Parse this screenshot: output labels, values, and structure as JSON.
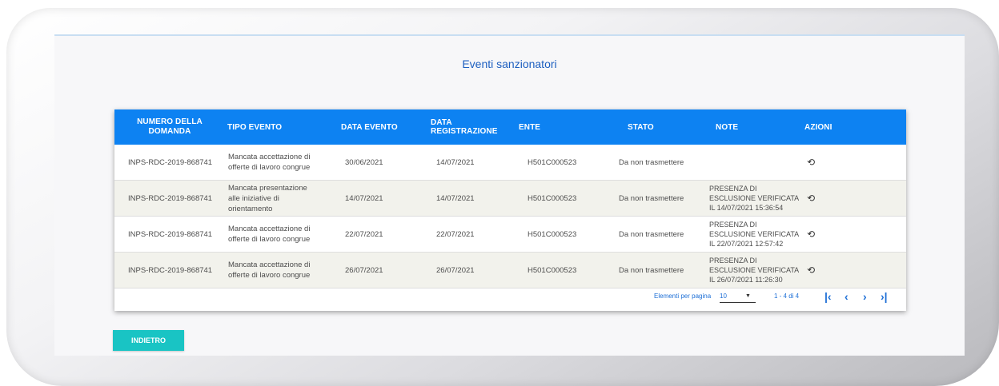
{
  "page": {
    "title": "Eventi sanzionatori"
  },
  "table": {
    "headers": {
      "numero": "NUMERO DELLA DOMANDA",
      "tipo": "TIPO EVENTO",
      "data_evento": "DATA EVENTO",
      "data_registrazione": "DATA REGISTRAZIONE",
      "ente": "ENTE",
      "stato": "STATO",
      "note": "NOTE",
      "azioni": "AZIONI"
    },
    "rows": [
      {
        "numero": "INPS-RDC-2019-868741",
        "tipo": "Mancata accettazione di offerte di lavoro congrue",
        "data_evento": "30/06/2021",
        "data_registrazione": "14/07/2021",
        "ente": "H501C000523",
        "stato": "Da non trasmettere",
        "note": ""
      },
      {
        "numero": "INPS-RDC-2019-868741",
        "tipo": "Mancata presentazione alle iniziative di orientamento",
        "data_evento": "14/07/2021",
        "data_registrazione": "14/07/2021",
        "ente": "H501C000523",
        "stato": "Da non trasmettere",
        "note": "PRESENZA DI ESCLUSIONE VERIFICATA IL 14/07/2021 15:36:54"
      },
      {
        "numero": "INPS-RDC-2019-868741",
        "tipo": "Mancata accettazione di offerte di lavoro congrue",
        "data_evento": "22/07/2021",
        "data_registrazione": "22/07/2021",
        "ente": "H501C000523",
        "stato": "Da non trasmettere",
        "note": "PRESENZA DI ESCLUSIONE VERIFICATA IL 22/07/2021 12:57:42"
      },
      {
        "numero": "INPS-RDC-2019-868741",
        "tipo": "Mancata accettazione di offerte di lavoro congrue",
        "data_evento": "26/07/2021",
        "data_registrazione": "26/07/2021",
        "ente": "H501C000523",
        "stato": "Da non trasmettere",
        "note": "PRESENZA DI ESCLUSIONE VERIFICATA IL 26/07/2021 11:26:30"
      }
    ],
    "row_action_icon": "history-icon"
  },
  "pagination": {
    "label": "Elementi per pagina",
    "page_size": "10",
    "range": "1 - 4 di 4",
    "icons": [
      "first-page-icon",
      "prev-page-icon",
      "next-page-icon",
      "last-page-icon"
    ]
  },
  "back_button": {
    "label": "INDIETRO"
  },
  "colors": {
    "header": "#0d82f2",
    "accent": "#1d5fc0",
    "button": "#19c4c4"
  }
}
